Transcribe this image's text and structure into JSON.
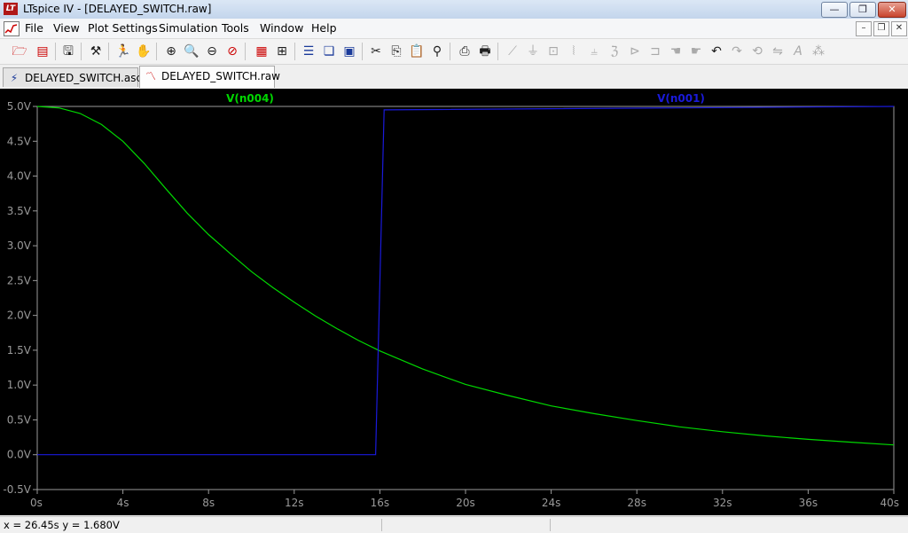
{
  "window": {
    "title": "LTspice IV - [DELAYED_SWITCH.raw]",
    "app_icon_text": "LT",
    "minimize_glyph": "—",
    "maximize_glyph": "❐",
    "close_glyph": "✕"
  },
  "menu": {
    "items": [
      "File",
      "View",
      "Plot Settings",
      "Simulation",
      "Tools",
      "Window",
      "Help"
    ],
    "mdi_minimize": "–",
    "mdi_restore": "❐",
    "mdi_close": "✕"
  },
  "toolbar": {
    "icons": [
      "open-icon",
      "save-icon",
      "control-panel-icon",
      "run-icon",
      "halt-icon",
      "pan-icon",
      "zoom-in-icon",
      "zoom-area-icon",
      "zoom-out-icon",
      "zoom-cancel-icon",
      "autorange-icon",
      "tile-vertical-icon",
      "tile-horizontal-icon",
      "cascade-icon",
      "windows-icon",
      "cut-icon",
      "copy-icon",
      "paste-icon",
      "find-icon",
      "print-preview-icon",
      "print-icon",
      "wire-icon",
      "ground-icon",
      "label-net-icon",
      "resistor-icon",
      "capacitor-icon",
      "inductor-icon",
      "diode-icon",
      "component-icon",
      "move-icon",
      "drag-icon",
      "undo-icon",
      "redo-icon",
      "rotate-icon",
      "mirror-icon",
      "text-icon",
      "spice-directive-icon"
    ]
  },
  "tabs": [
    {
      "label": "DELAYED_SWITCH.asc",
      "icon": "schematic-icon",
      "active": false
    },
    {
      "label": "DELAYED_SWITCH.raw",
      "icon": "waveform-icon",
      "active": true
    }
  ],
  "status": {
    "cursor_readout": "x = 26.45s    y = 1.680V"
  },
  "colors": {
    "plot_bg": "#000000",
    "trace_n004": "#00d800",
    "trace_n001": "#1a1adb",
    "axis": "#9a9a9a"
  },
  "chart_data": {
    "type": "line",
    "xlabel": "",
    "ylabel": "",
    "xlim": [
      0,
      40
    ],
    "ylim": [
      -0.5,
      5.0
    ],
    "x_ticks": [
      "0s",
      "4s",
      "8s",
      "12s",
      "16s",
      "20s",
      "24s",
      "28s",
      "32s",
      "36s",
      "40s"
    ],
    "x_tick_values": [
      0,
      4,
      8,
      12,
      16,
      20,
      24,
      28,
      32,
      36,
      40
    ],
    "y_ticks": [
      "5.0V",
      "4.5V",
      "4.0V",
      "3.5V",
      "3.0V",
      "2.5V",
      "2.0V",
      "1.5V",
      "1.0V",
      "0.5V",
      "0.0V",
      "-0.5V"
    ],
    "y_tick_values": [
      5.0,
      4.5,
      4.0,
      3.5,
      3.0,
      2.5,
      2.0,
      1.5,
      1.0,
      0.5,
      0.0,
      -0.5
    ],
    "grid": false,
    "series": [
      {
        "name": "V(n004)",
        "color": "#00d800",
        "x": [
          0,
          1,
          2,
          3,
          4,
          5,
          6,
          7,
          8,
          9,
          10,
          11,
          12,
          13,
          14,
          15,
          16,
          17,
          18,
          19,
          20,
          22,
          24,
          26,
          28,
          30,
          32,
          34,
          36,
          38,
          40
        ],
        "y": [
          5.0,
          4.98,
          4.9,
          4.74,
          4.5,
          4.18,
          3.82,
          3.47,
          3.16,
          2.89,
          2.63,
          2.4,
          2.19,
          1.99,
          1.81,
          1.64,
          1.49,
          1.36,
          1.23,
          1.12,
          1.01,
          0.85,
          0.7,
          0.59,
          0.49,
          0.4,
          0.33,
          0.27,
          0.22,
          0.18,
          0.14
        ]
      },
      {
        "name": "V(n001)",
        "color": "#1a1adb",
        "x": [
          0,
          15.8,
          16.2,
          40
        ],
        "y": [
          0.0,
          0.0,
          4.95,
          5.0
        ]
      }
    ]
  }
}
